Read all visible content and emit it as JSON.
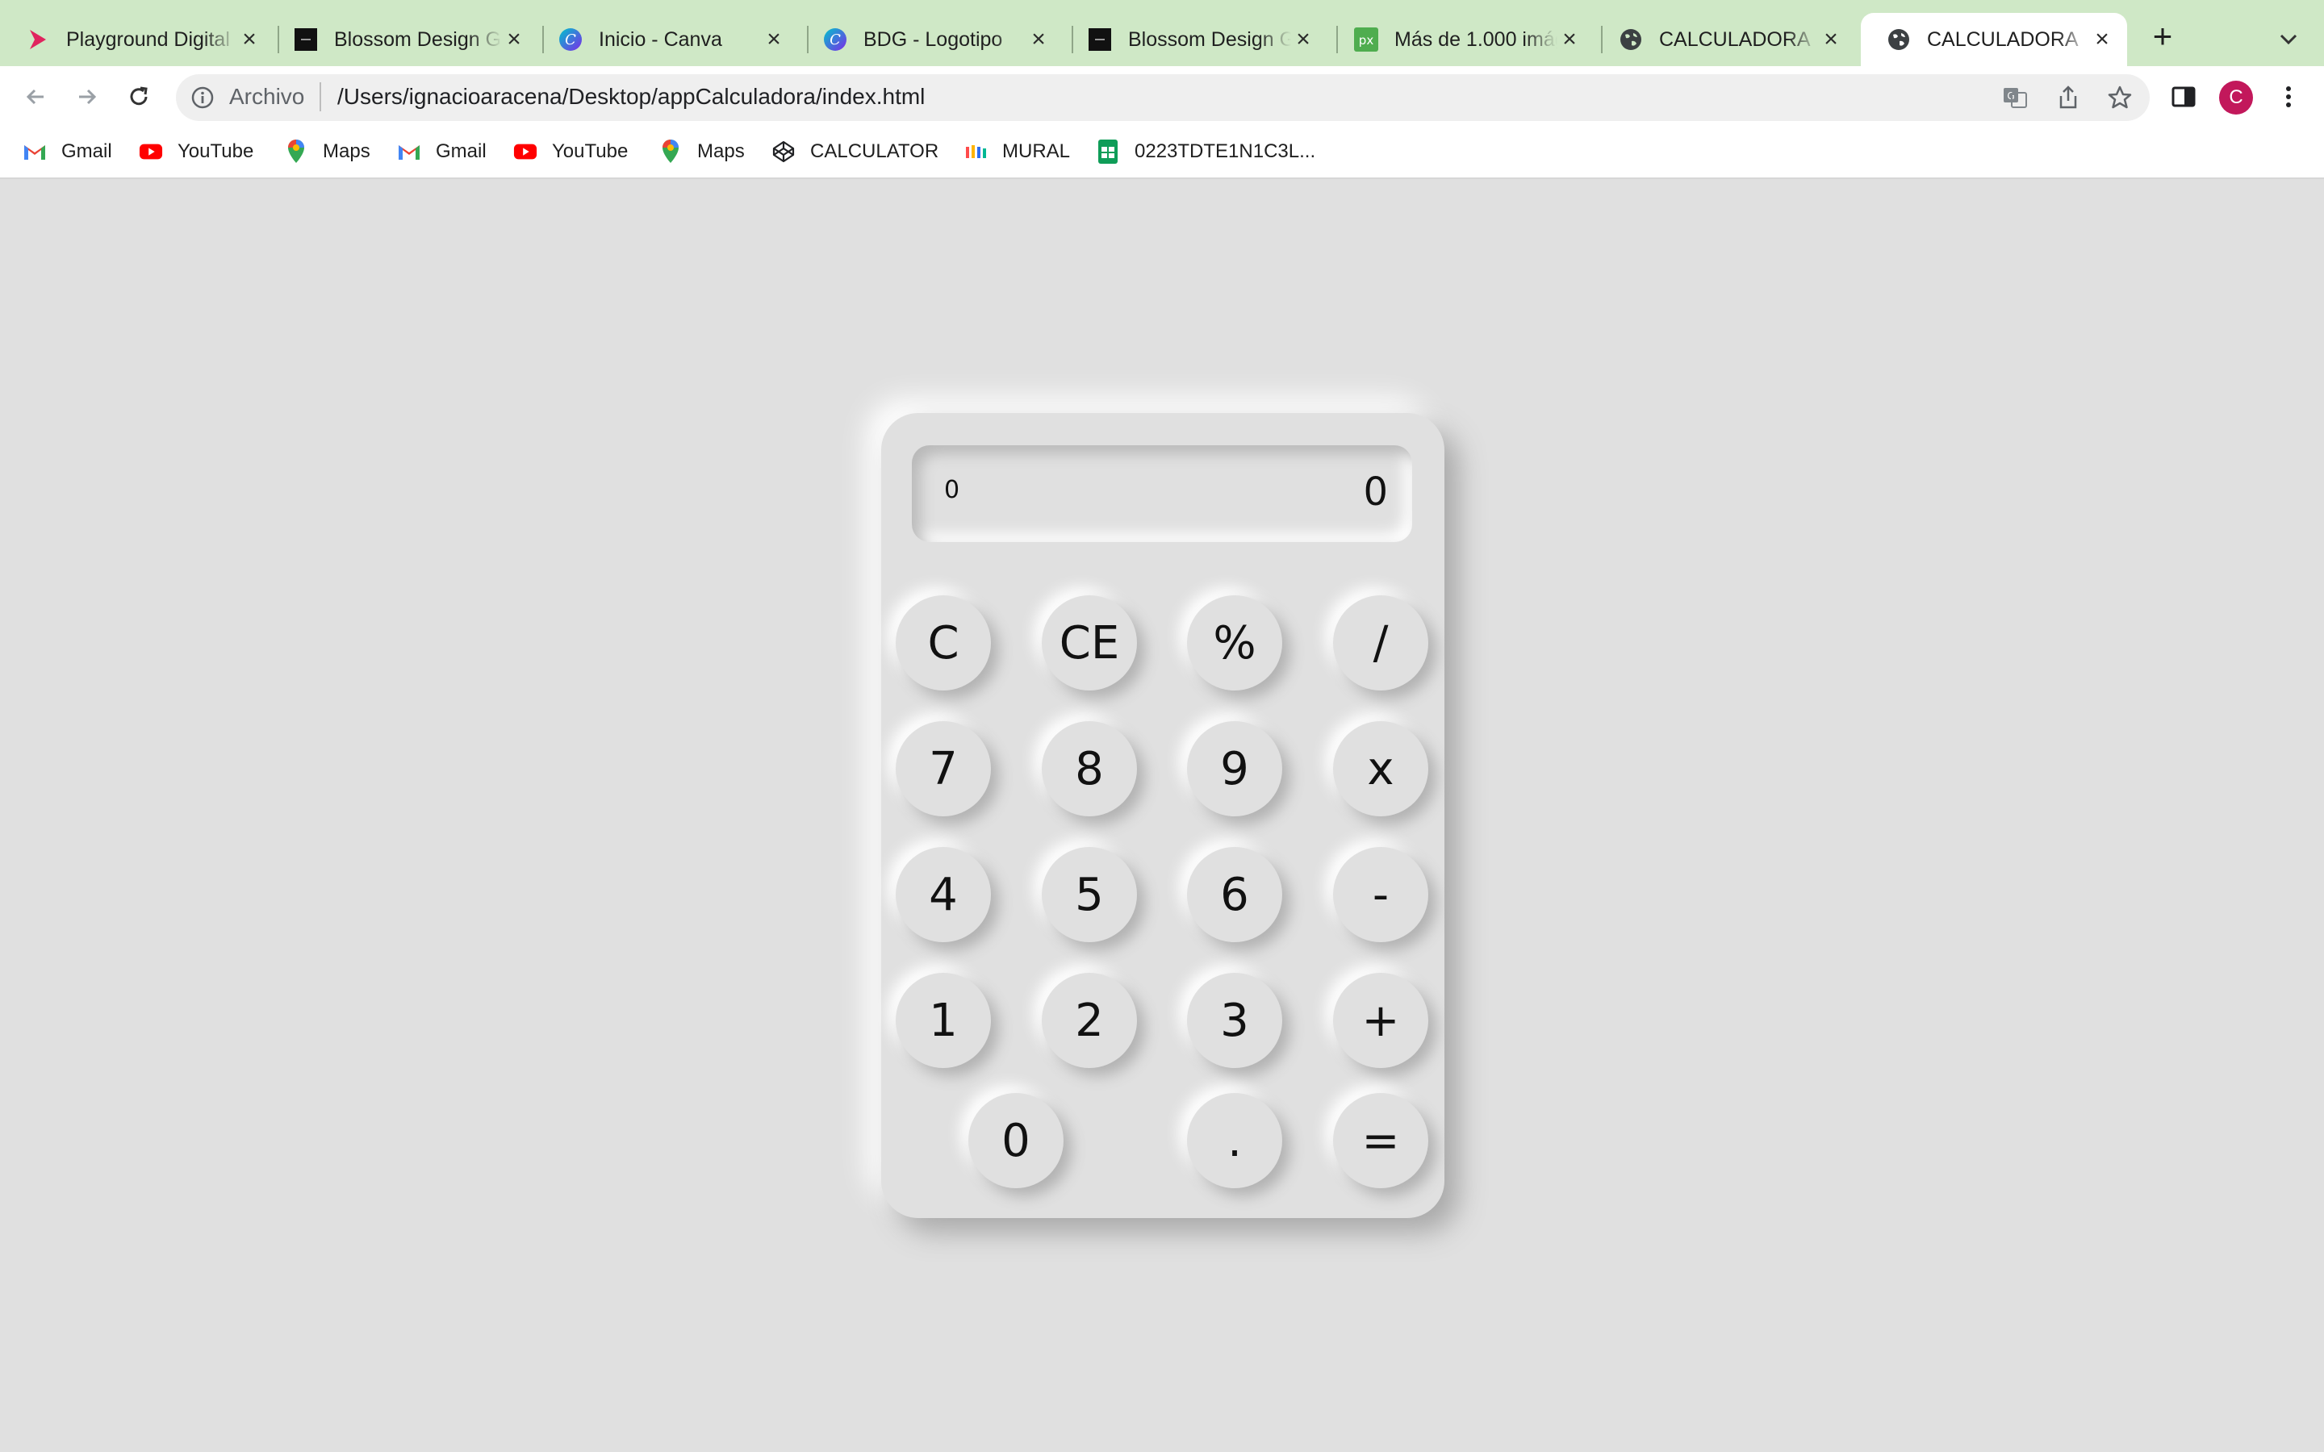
{
  "browser": {
    "tabs": [
      {
        "label": "Playground Digital",
        "icon": "playground-chevron-icon"
      },
      {
        "label": "Blossom Design Group",
        "icon": "blossom-square-icon"
      },
      {
        "label": "Inicio - Canva",
        "icon": "canva-icon"
      },
      {
        "label": "BDG - Logotipo",
        "icon": "canva-icon"
      },
      {
        "label": "Blossom Design Group",
        "icon": "blossom-square-icon"
      },
      {
        "label": "Más de 1.000 imágenes",
        "icon": "pixabay-icon"
      },
      {
        "label": "CALCULADORA",
        "icon": "globe-icon"
      },
      {
        "label": "CALCULADORA",
        "icon": "globe-icon",
        "active": true
      }
    ],
    "omnibox": {
      "scheme_label": "Archivo",
      "url": "/Users/ignacioaracena/Desktop/appCalculadora/index.html"
    },
    "profile_initial": "C",
    "bookmarks": [
      {
        "label": "Gmail",
        "icon": "gmail-icon"
      },
      {
        "label": "YouTube",
        "icon": "youtube-icon"
      },
      {
        "label": "Maps",
        "icon": "maps-pin-icon"
      },
      {
        "label": "Gmail",
        "icon": "gmail-icon"
      },
      {
        "label": "YouTube",
        "icon": "youtube-icon"
      },
      {
        "label": "Maps",
        "icon": "maps-pin-icon"
      },
      {
        "label": "CALCULATOR",
        "icon": "codepen-icon"
      },
      {
        "label": "MURAL",
        "icon": "mural-icon"
      },
      {
        "label": "0223TDTE1N1C3L...",
        "icon": "sheets-icon"
      }
    ],
    "colors": {
      "tabstrip": "#cfe8c6",
      "page_bg": "#e0e0e0",
      "avatar": "#c2185b"
    }
  },
  "calculator": {
    "display": {
      "previous": "0",
      "current": "0"
    },
    "keys": {
      "clear": "C",
      "clear_entry": "CE",
      "percent": "%",
      "divide": "/",
      "seven": "7",
      "eight": "8",
      "nine": "9",
      "multiply": "x",
      "four": "4",
      "five": "5",
      "six": "6",
      "subtract": "-",
      "one": "1",
      "two": "2",
      "three": "3",
      "add": "+",
      "zero": "0",
      "decimal": ".",
      "equals": "="
    }
  }
}
